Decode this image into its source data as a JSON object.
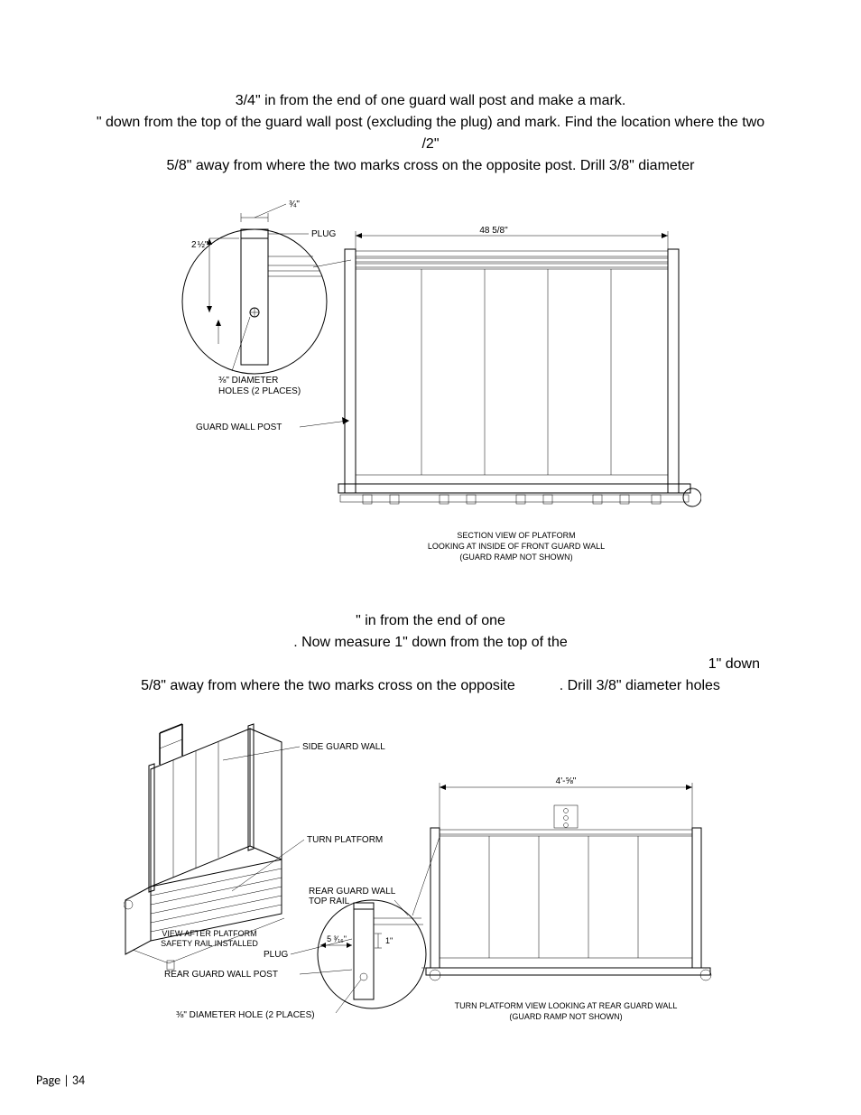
{
  "para1": {
    "l1": "3/4\" in from the end of one guard wall post and make a mark.",
    "l2": "\" down from the top of the guard wall post (excluding the plug) and mark. Find the location where the two",
    "l3": "/2\"",
    "l4a": "5/8\" away from where the two marks cross on the opposite post. Drill 3/8\" diameter",
    "figlink": " "
  },
  "fig1": {
    "three_quarter": "¾\"",
    "two_half_1": "2",
    "two_half_2": "½\"",
    "plug": "PLUG",
    "width": "48 5/8\"",
    "diam1": "⅜\" DIAMETER",
    "diam2": "HOLES (2 PLACES)",
    "postlabel": "GUARD WALL POST",
    "cap1": "SECTION VIEW OF PLATFORM",
    "cap2": "LOOKING AT INSIDE OF FRONT GUARD WALL",
    "cap3": "(GUARD RAMP NOT SHOWN)"
  },
  "para2": {
    "l1": "\" in from the end of one",
    "l2": ". Now measure 1\" down from the top of the",
    "l3a": "1\" down",
    "l4a": "5/8\" away from where the two marks cross on the opposite",
    "l4b": ". Drill 3/8\" diameter holes",
    "figlink": " "
  },
  "fig2": {
    "side": "SIDE GUARD WALL",
    "turn": "TURN PLATFORM",
    "width": "4'-⅝\"",
    "toprail1": "REAR GUARD WALL",
    "toprail2": "TOP RAIL",
    "installed1": "VIEW AFTER PLATFORM",
    "installed2": "SAFETY RAIL INSTALLED",
    "plug": "PLUG",
    "five316": "5 ³⁄₁₆\"",
    "one_inch": "1\"",
    "rearpost": "REAR GUARD WALL POST",
    "diam": "⅜\" DIAMETER HOLE (2 PLACES)",
    "cap1": "TURN PLATFORM VIEW LOOKING AT REAR GUARD WALL",
    "cap2": "(GUARD RAMP NOT SHOWN)"
  },
  "footer": "Page | 34"
}
